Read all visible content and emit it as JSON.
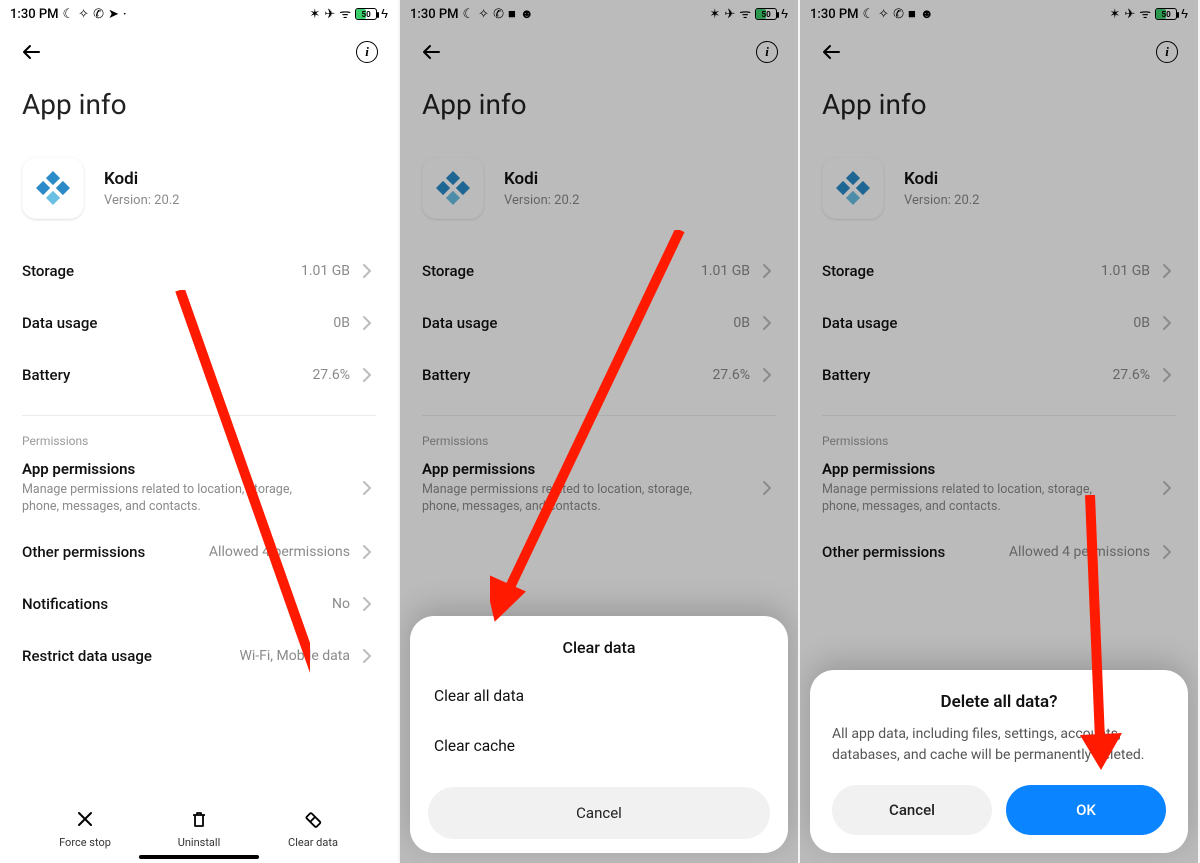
{
  "status": {
    "time": "1:30 PM",
    "battery_pct": "50"
  },
  "page": {
    "title": "App info"
  },
  "app": {
    "name": "Kodi",
    "version_label": "Version: 20.2"
  },
  "rows": {
    "storage": {
      "label": "Storage",
      "value": "1.01 GB"
    },
    "data_usage": {
      "label": "Data usage",
      "value": "0B"
    },
    "battery": {
      "label": "Battery",
      "value": "27.6%"
    }
  },
  "permissions": {
    "section_label": "Permissions",
    "app_permissions": {
      "label": "App permissions",
      "sub": "Manage permissions related to location, storage, phone, messages, and contacts."
    },
    "other": {
      "label": "Other permissions",
      "value": "Allowed 4 permissions"
    },
    "notifications": {
      "label": "Notifications",
      "value": "No"
    },
    "restrict": {
      "label": "Restrict data usage",
      "value": "Wi-Fi, Mobile data"
    }
  },
  "bottom_actions": {
    "force_stop": "Force stop",
    "uninstall": "Uninstall",
    "clear_data": "Clear data"
  },
  "sheet": {
    "title": "Clear data",
    "clear_all": "Clear all data",
    "clear_cache": "Clear cache",
    "cancel": "Cancel"
  },
  "dialog": {
    "title": "Delete all data?",
    "body": "All app data, including files, settings, accounts, databases, and cache will be permanently deleted.",
    "cancel": "Cancel",
    "ok": "OK"
  }
}
